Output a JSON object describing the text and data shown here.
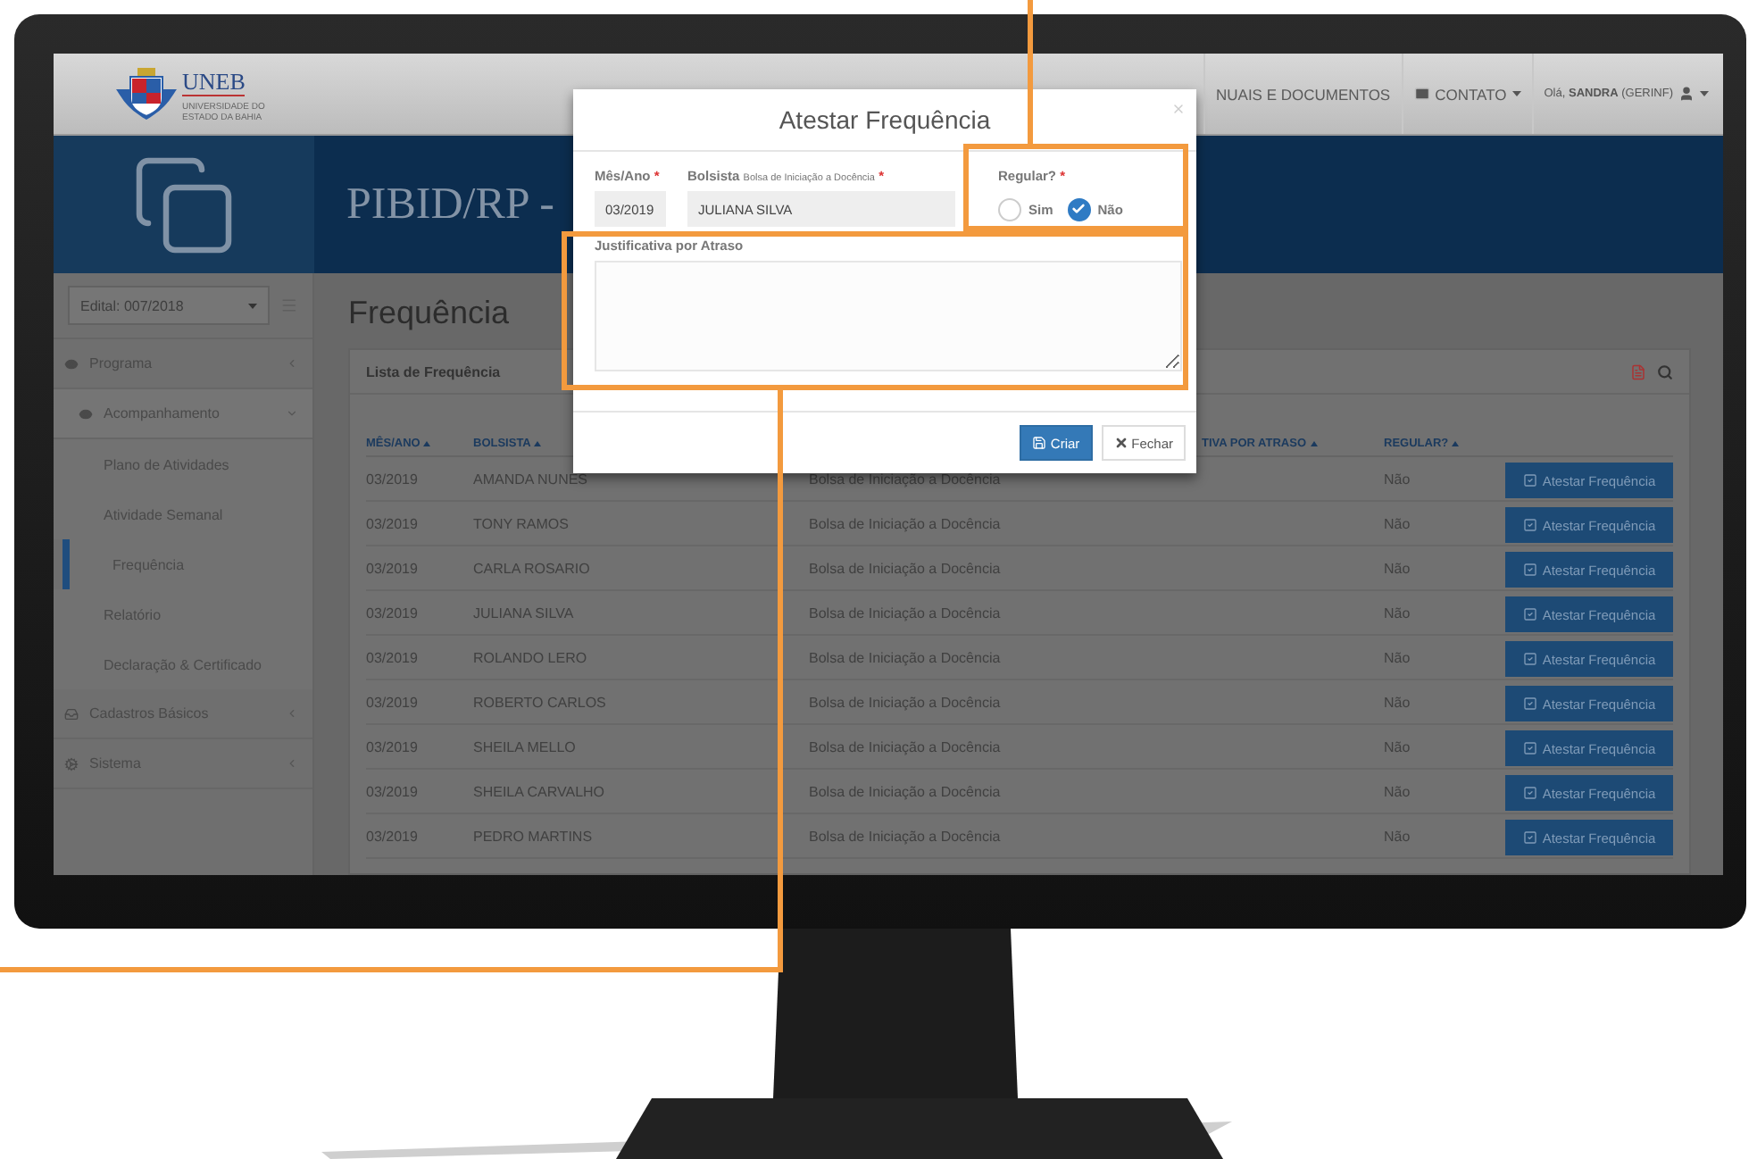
{
  "navbar": {
    "logo_text": "UNEB",
    "logo_subtitle": "UNIVERSIDADE DO ESTADO DA BAHIA",
    "links": [
      {
        "label": "NUAIS E DOCUMENTOS"
      },
      {
        "label": "CONTATO"
      }
    ],
    "user": "Olá, **SANDRA** (GERINF)"
  },
  "banner": {
    "title": "PIBID/RP -"
  },
  "sidebar": {
    "edital": "Edital: 007/2018",
    "items": [
      {
        "label": "Programa",
        "expanded": false
      },
      {
        "label": "Acompanhamento",
        "expanded": true,
        "children": [
          {
            "label": "Plano de Atividades",
            "selected": false
          },
          {
            "label": "Atividade Semanal",
            "selected": false
          },
          {
            "label": "Frequência",
            "selected": true
          },
          {
            "label": "Relatório",
            "selected": false
          },
          {
            "label": "Declaração & Certificado",
            "selected": false
          }
        ]
      },
      {
        "label": "Cadastros Básicos",
        "expanded": false
      },
      {
        "label": "Sistema",
        "expanded": false
      }
    ]
  },
  "page": {
    "title": "Frequência"
  },
  "panel": {
    "title": "Lista de Frequência"
  },
  "table": {
    "columns": [
      {
        "label": "MÊS/ANO"
      },
      {
        "label": "BOLSISTA"
      },
      {
        "label": "TIVA POR ATRASO"
      },
      {
        "label": "REGULAR?"
      }
    ],
    "rows": [
      {
        "month": "03/2019",
        "name": "AMANDA NUNES",
        "grant": "Bolsa de Iniciação a Docência",
        "regular": "Não",
        "action": "Atestar Frequência"
      },
      {
        "month": "03/2019",
        "name": "TONY RAMOS",
        "grant": "Bolsa de Iniciação a Docência",
        "regular": "Não",
        "action": "Atestar Frequência"
      },
      {
        "month": "03/2019",
        "name": "CARLA ROSARIO",
        "grant": "Bolsa de Iniciação a Docência",
        "regular": "Não",
        "action": "Atestar Frequência"
      },
      {
        "month": "03/2019",
        "name": "JULIANA SILVA",
        "grant": "Bolsa de Iniciação a Docência",
        "regular": "Não",
        "action": "Atestar Frequência"
      },
      {
        "month": "03/2019",
        "name": "ROLANDO LERO",
        "grant": "Bolsa de Iniciação a Docência",
        "regular": "Não",
        "action": "Atestar Frequência"
      },
      {
        "month": "03/2019",
        "name": "ROBERTO CARLOS",
        "grant": "Bolsa de Iniciação a Docência",
        "regular": "Não",
        "action": "Atestar Frequência"
      },
      {
        "month": "03/2019",
        "name": "SHEILA MELLO",
        "grant": "Bolsa de Iniciação a Docência",
        "regular": "Não",
        "action": "Atestar Frequência"
      },
      {
        "month": "03/2019",
        "name": "SHEILA CARVALHO",
        "grant": "Bolsa de Iniciação a Docência",
        "regular": "Não",
        "action": "Atestar Frequência"
      },
      {
        "month": "03/2019",
        "name": "PEDRO MARTINS",
        "grant": "Bolsa de Iniciação a Docência",
        "regular": "Não",
        "action": "Atestar Frequência"
      }
    ]
  },
  "modal": {
    "title": "Atestar Frequência",
    "fields": [
      {
        "label": "Mês/Ano",
        "required_mark": "*",
        "value": "03/2019"
      },
      {
        "label": "Bolsista",
        "hint": "Bolsa de Iniciação a Docência",
        "required_mark": "*",
        "value": "JULIANA SILVA"
      }
    ],
    "regular": {
      "label": "Regular?",
      "required_mark": "*",
      "options": [
        {
          "label": "Sim",
          "selected": false
        },
        {
          "label": "Não",
          "selected": true
        }
      ]
    },
    "justification": {
      "label": "Justificativa por Atraso"
    },
    "buttons": [
      {
        "kind": "primary",
        "label": "Criar"
      },
      {
        "kind": "default",
        "label": "Fechar"
      }
    ]
  }
}
